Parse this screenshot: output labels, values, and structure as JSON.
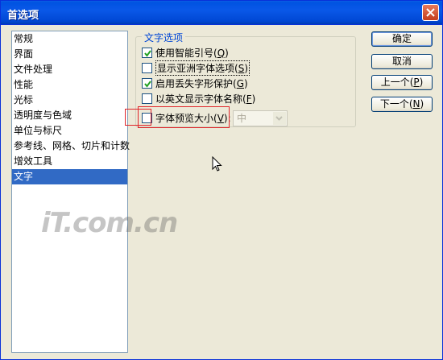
{
  "window": {
    "title": "首选项"
  },
  "nav": {
    "items": [
      {
        "label": "常规",
        "selected": false
      },
      {
        "label": "界面",
        "selected": false
      },
      {
        "label": "文件处理",
        "selected": false
      },
      {
        "label": "性能",
        "selected": false
      },
      {
        "label": "光标",
        "selected": false
      },
      {
        "label": "透明度与色域",
        "selected": false
      },
      {
        "label": "单位与标尺",
        "selected": false
      },
      {
        "label": "参考线、网格、切片和计数",
        "selected": false
      },
      {
        "label": "增效工具",
        "selected": false
      },
      {
        "label": "文字",
        "selected": true
      }
    ]
  },
  "text_options": {
    "group_title": "文字选项",
    "smart_quotes": {
      "text": "使用智能引号(",
      "key": "Q",
      "tail": ")",
      "checked": true
    },
    "asian_options": {
      "text": "显示亚洲字体选项(",
      "key": "S",
      "tail": ")",
      "checked": false
    },
    "missing_glyph": {
      "text": "启用丢失字形保护(",
      "key": "G",
      "tail": ")",
      "checked": true
    },
    "english_names": {
      "text": "以英文显示字体名称(",
      "key": "F",
      "tail": ")",
      "checked": false
    },
    "font_preview": {
      "text": "字体预览大小(",
      "key": "V",
      "tail": "):",
      "checked": false
    },
    "preview_size": {
      "value": "中"
    }
  },
  "buttons": {
    "ok": {
      "label": "确定"
    },
    "cancel": {
      "label": "取消"
    },
    "prev": {
      "text": "上一个(",
      "key": "P",
      "tail": ")"
    },
    "next": {
      "text": "下一个(",
      "key": "N",
      "tail": ")"
    }
  },
  "watermark": {
    "text": "iT.com.cn"
  }
}
